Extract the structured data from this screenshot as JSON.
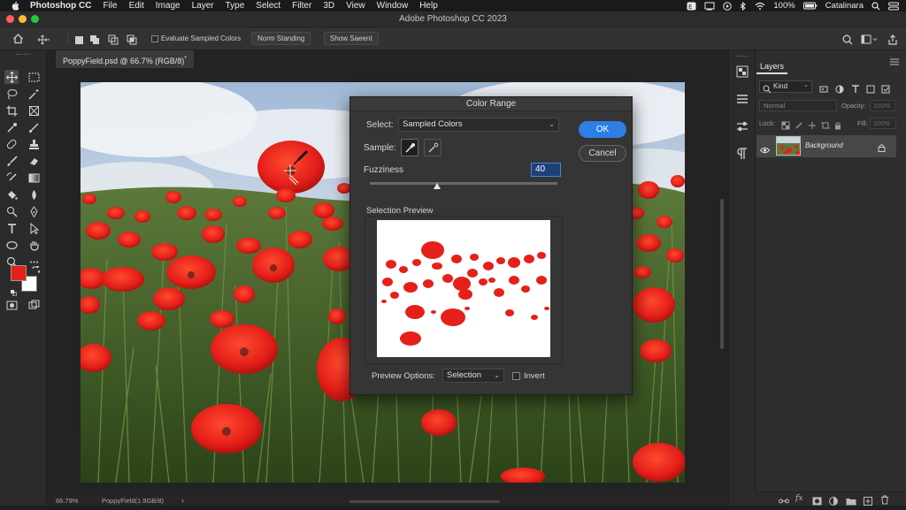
{
  "menubar": {
    "app": "Photoshop CC",
    "items": [
      "File",
      "Edit",
      "Image",
      "Layer",
      "Type",
      "Select",
      "Filter",
      "3D",
      "View",
      "Window",
      "Help"
    ],
    "battery": "100%",
    "user": "Catalinara"
  },
  "window": {
    "title": "Adobe Photoshop CC 2023"
  },
  "options": {
    "evaluate_label": "Evaluate Sampled Colors",
    "btn1": "Norm Standing",
    "btn2": "Show Saeent"
  },
  "document": {
    "tab_label": "PoppyField.psd @ 66.7% (RGB/8)",
    "tab_suffix": "*",
    "zoom": "66.79%",
    "status_info": "PoppyField(1.9GB/8)",
    "status_arrow": "›"
  },
  "colors": {
    "foreground": "#e5201a",
    "background": "#ffffff",
    "accent": "#2d7fe6"
  },
  "layers_panel": {
    "tab": "Layers",
    "filter_kind": "Kind",
    "blend_mode": "Normal",
    "opacity_label": "Opacity:",
    "opacity_value": "100%",
    "lock_label": "Lock:",
    "fill_label": "Fill:",
    "fill_value": "100%",
    "layer_name": "Background"
  },
  "dialog": {
    "title": "Color Range",
    "select_label": "Select:",
    "select_value": "Sampled Colors",
    "sample_label": "Sample:",
    "fuzziness_label": "Fuzziness",
    "fuzziness_value": "40",
    "fuzziness_level": 40,
    "section_label": "Selection Preview",
    "preview_options_label": "Preview Options:",
    "preview_options_value": "Selection",
    "invert_label": "Invert",
    "ok_label": "OK",
    "cancel_label": "Cancel"
  }
}
